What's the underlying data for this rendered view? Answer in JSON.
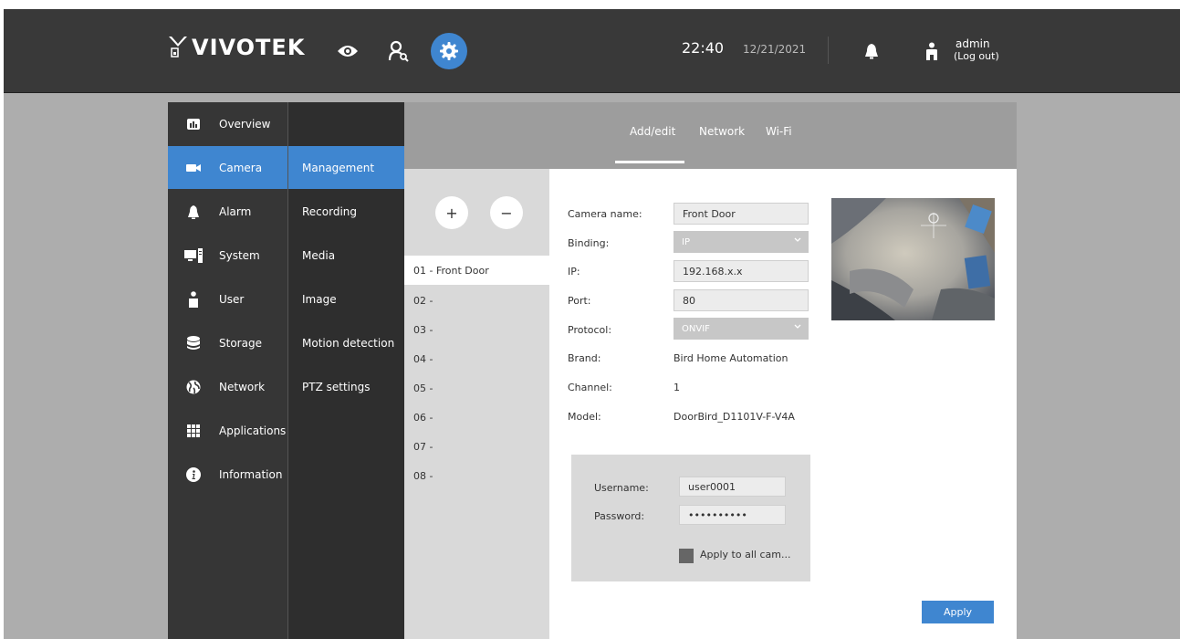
{
  "brand": {
    "name": "VIVOTEK"
  },
  "header": {
    "time": "22:40",
    "date": "12/21/2021",
    "user": "admin",
    "logout": "(Log out)",
    "icons": [
      "eye-icon",
      "user-search-icon",
      "gear-icon",
      "bell-icon",
      "user-icon"
    ]
  },
  "nav": {
    "primary": [
      {
        "label": "Overview",
        "icon": "chart-icon"
      },
      {
        "label": "Camera",
        "icon": "camera-icon",
        "active": true
      },
      {
        "label": "Alarm",
        "icon": "bell-icon"
      },
      {
        "label": "System",
        "icon": "computer-icon"
      },
      {
        "label": "User",
        "icon": "person-icon"
      },
      {
        "label": "Storage",
        "icon": "database-icon"
      },
      {
        "label": "Network",
        "icon": "globe-icon"
      },
      {
        "label": "Applications",
        "icon": "grid-icon"
      },
      {
        "label": "Information",
        "icon": "info-icon"
      }
    ],
    "secondary": [
      {
        "label": "Management",
        "active": true
      },
      {
        "label": "Recording"
      },
      {
        "label": "Media"
      },
      {
        "label": "Image"
      },
      {
        "label": "Motion detection"
      },
      {
        "label": "PTZ settings"
      }
    ]
  },
  "tabs": [
    {
      "label": "Add/edit",
      "active": true
    },
    {
      "label": "Network"
    },
    {
      "label": "Wi-Fi"
    }
  ],
  "camera_list": {
    "add_label": "+",
    "remove_label": "−",
    "items": [
      "01 - Front Door",
      "02 -",
      "03 -",
      "04 -",
      "05 -",
      "06 -",
      "07 -",
      "08 -"
    ]
  },
  "form": {
    "camera_name": {
      "label": "Camera name:",
      "value": "Front Door"
    },
    "binding": {
      "label": "Binding:",
      "value": "IP"
    },
    "ip": {
      "label": "IP:",
      "value": "192.168.x.x"
    },
    "port": {
      "label": "Port:",
      "value": "80"
    },
    "protocol": {
      "label": "Protocol:",
      "value": "ONVIF"
    },
    "brand": {
      "label": "Brand:",
      "value": "Bird Home Automation"
    },
    "channel": {
      "label": "Channel:",
      "value": "1"
    },
    "model": {
      "label": "Model:",
      "value": "DoorBird_D1101V-F-V4A"
    }
  },
  "credentials": {
    "username": {
      "label": "Username:",
      "value": "user0001"
    },
    "password": {
      "label": "Password:",
      "value": "••••••••••"
    },
    "apply_all": "Apply to all cam..."
  },
  "apply_label": "Apply",
  "colors": {
    "accent": "#3f86d0",
    "topbar": "#393939",
    "nav": "#363636"
  }
}
